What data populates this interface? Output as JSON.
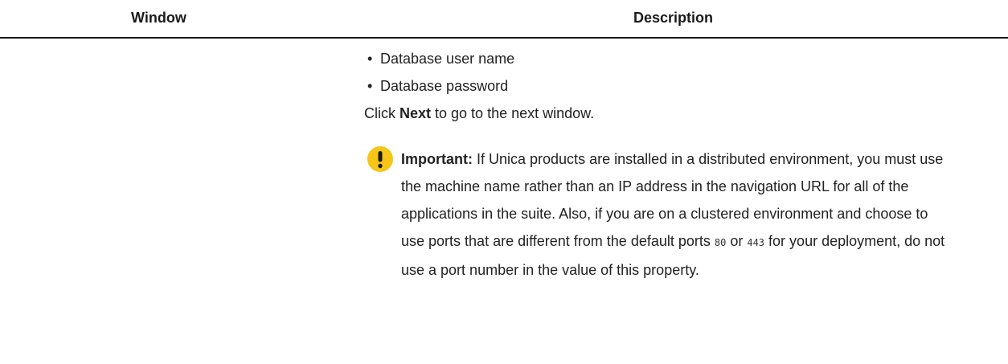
{
  "table": {
    "headers": {
      "window": "Window",
      "description": "Description"
    }
  },
  "description": {
    "bullets": [
      "Database user name",
      "Database password"
    ],
    "bullet_glyph": "•",
    "instruction": {
      "before": "Click ",
      "bold": "Next",
      "after": " to go to the next window."
    },
    "note": {
      "icon": "exclamation-icon",
      "icon_color": "#f5c518",
      "label": "Important:",
      "text_1": " If Unica products are installed in a distributed environment, you must use the machine name rather than an IP address in the navigation URL for all of the applications in the suite. Also, if you are on a clustered environment and choose to use ports that are different from the default ports ",
      "port_1": "80",
      "text_2": " or ",
      "port_2": "443",
      "text_3": " for your deployment, do not use a port number in the value of this property."
    }
  }
}
